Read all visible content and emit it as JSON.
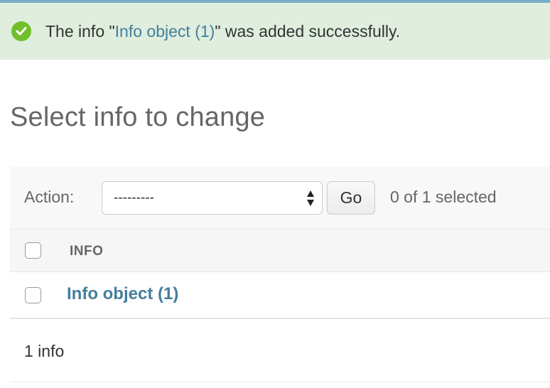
{
  "message": {
    "prefix": "The info \"",
    "link": "Info object (1)",
    "suffix": "\" was added successfully.",
    "icon": "success-check-icon"
  },
  "title": "Select info to change",
  "actions": {
    "label": "Action:",
    "selected_option": "---------",
    "go_label": "Go",
    "selection_counter": "0 of 1 selected"
  },
  "table": {
    "columns": [
      "INFO"
    ],
    "rows": [
      {
        "label": "Info object (1)"
      }
    ]
  },
  "paginator": {
    "count": "1 info"
  },
  "colors": {
    "accent": "#79aec8",
    "link": "#447e9b",
    "success_bg": "#dfeedd",
    "success_icon": "#70bf2b"
  }
}
